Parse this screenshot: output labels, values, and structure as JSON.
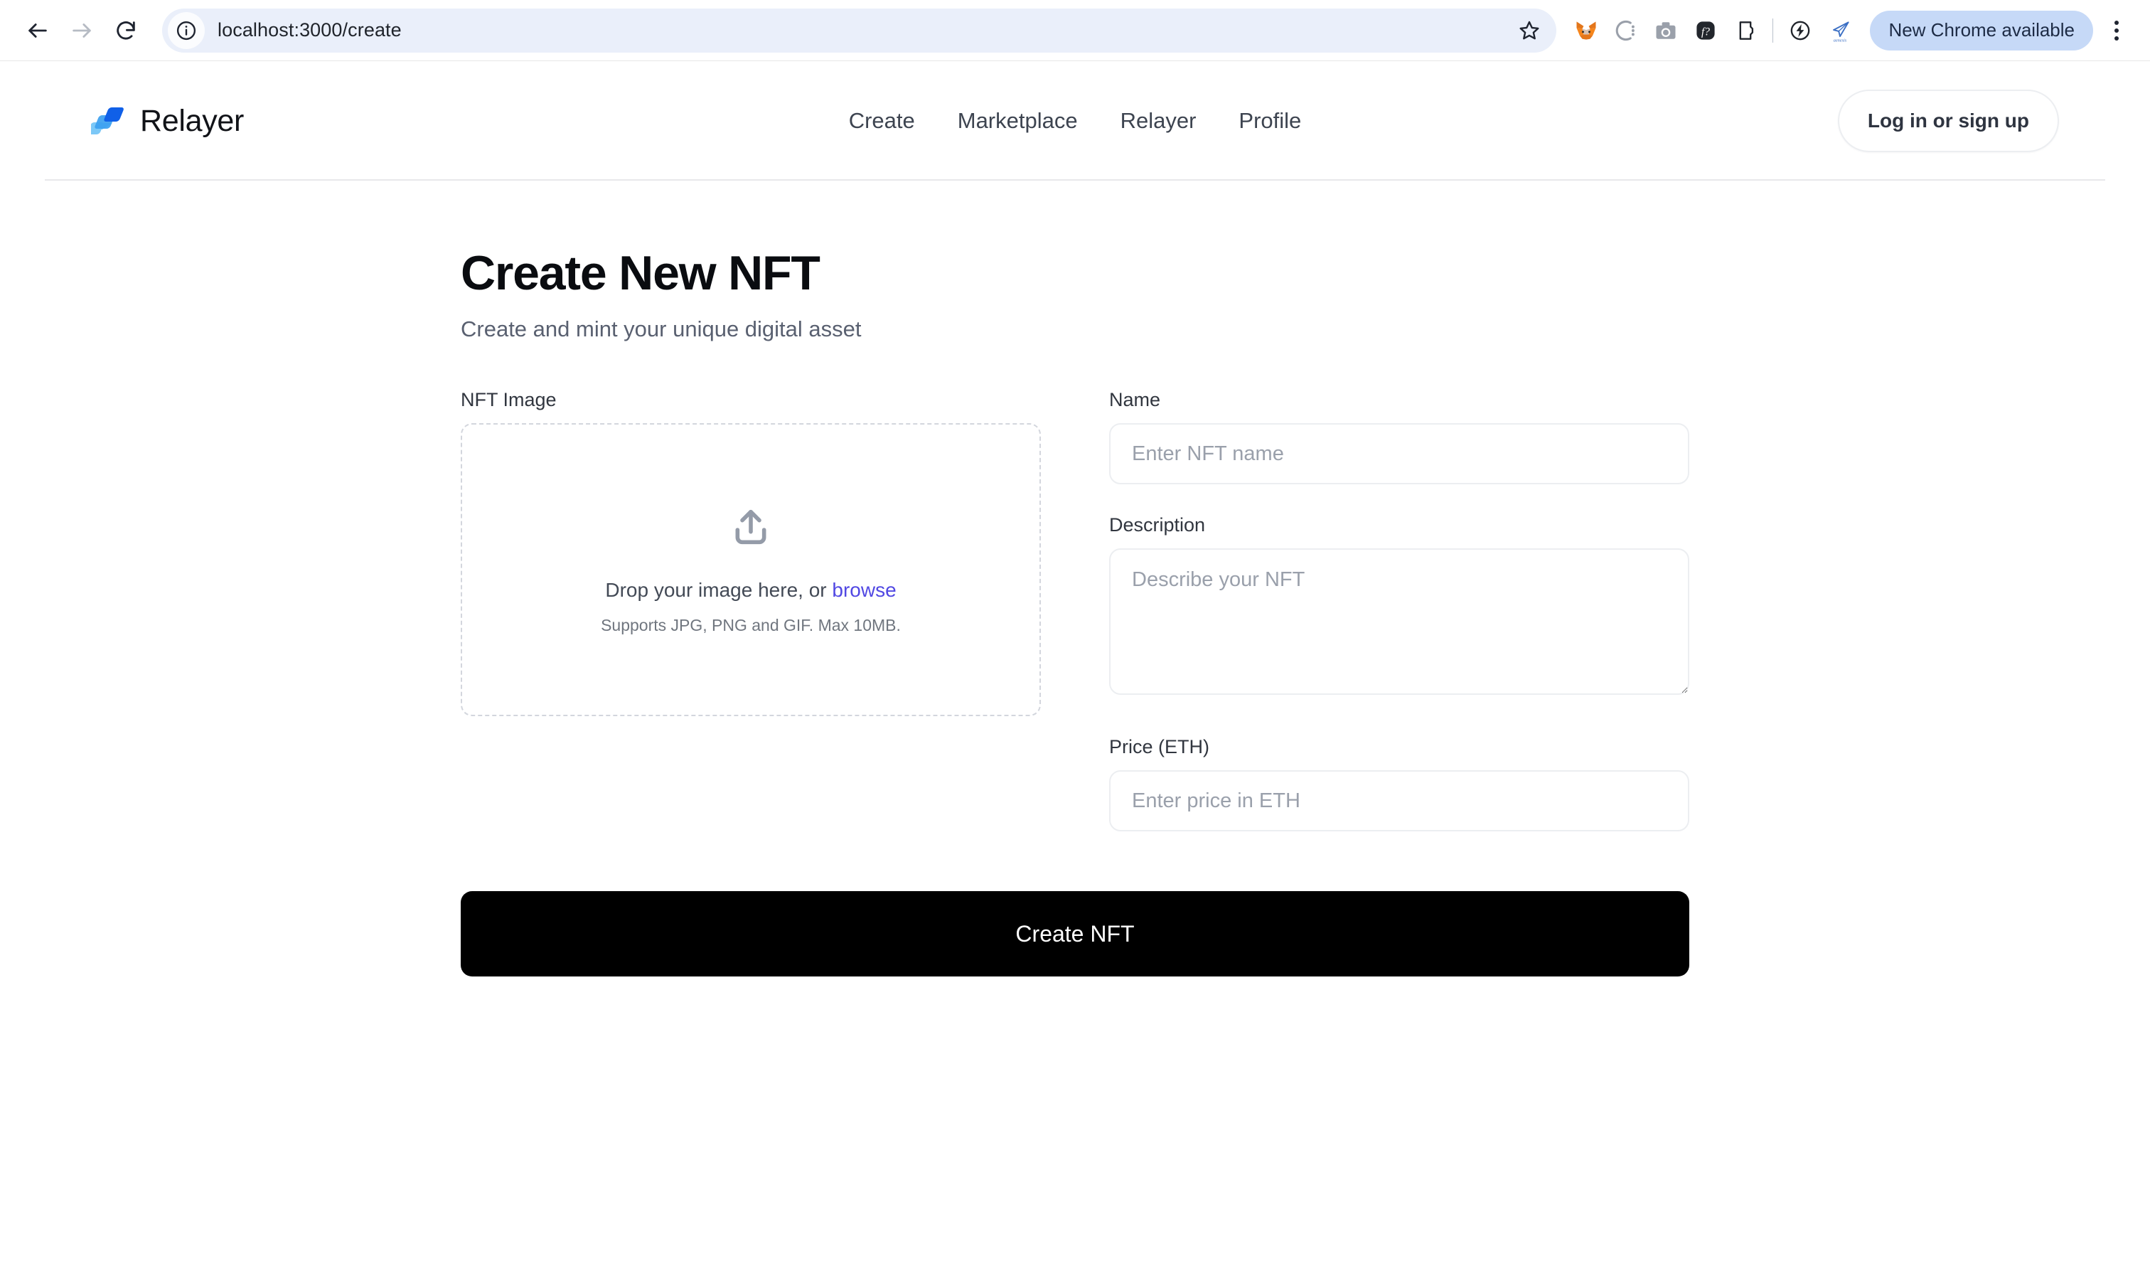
{
  "browser": {
    "back_label": "Back",
    "forward_label": "Forward",
    "reload_label": "Reload",
    "site_info_label": "View site information",
    "url": "localhost:3000/create",
    "bookmark_label": "Bookmark this tab",
    "extensions": [
      {
        "name": "metamask-extension-icon",
        "label": "MetaMask"
      },
      {
        "name": "coinbase-wallet-extension-icon",
        "label": "Coinbase Wallet"
      },
      {
        "name": "screenshot-extension-icon",
        "label": "Screenshot"
      },
      {
        "name": "formula-extension-icon",
        "label": "f?"
      },
      {
        "name": "keplr-wallet-extension-icon",
        "label": "Keplr"
      },
      {
        "name": "phantom-wallet-extension-icon",
        "label": "Phantom"
      },
      {
        "name": "genesis-extension-icon",
        "label": "Genesis"
      }
    ],
    "update_pill": "New Chrome available",
    "menu_label": "Customize and control Google Chrome"
  },
  "header": {
    "brand": "Relayer",
    "logo_colors": [
      "#7cc8f7",
      "#3b9ff0",
      "#1060e8"
    ],
    "nav": [
      {
        "label": "Create",
        "name": "nav-item-create"
      },
      {
        "label": "Marketplace",
        "name": "nav-item-marketplace"
      },
      {
        "label": "Relayer",
        "name": "nav-item-relayer"
      },
      {
        "label": "Profile",
        "name": "nav-item-profile"
      }
    ],
    "login_label": "Log in or sign up"
  },
  "main": {
    "title": "Create New NFT",
    "subtitle": "Create and mint your unique digital asset",
    "image_field": {
      "label": "NFT Image",
      "drop_text_before": "Drop your image here, or ",
      "browse_link": "browse",
      "hint": "Supports JPG, PNG and GIF. Max 10MB."
    },
    "name_field": {
      "label": "Name",
      "placeholder": "Enter NFT name",
      "value": ""
    },
    "description_field": {
      "label": "Description",
      "placeholder": "Describe your NFT",
      "value": ""
    },
    "price_field": {
      "label": "Price (ETH)",
      "placeholder": "Enter price in ETH",
      "value": ""
    },
    "submit_label": "Create NFT"
  },
  "colors": {
    "accent_link": "#5148e3",
    "submit_bg": "#000000",
    "omnibox_bg": "#eaeffa",
    "update_pill_bg": "#c6d9f7"
  }
}
